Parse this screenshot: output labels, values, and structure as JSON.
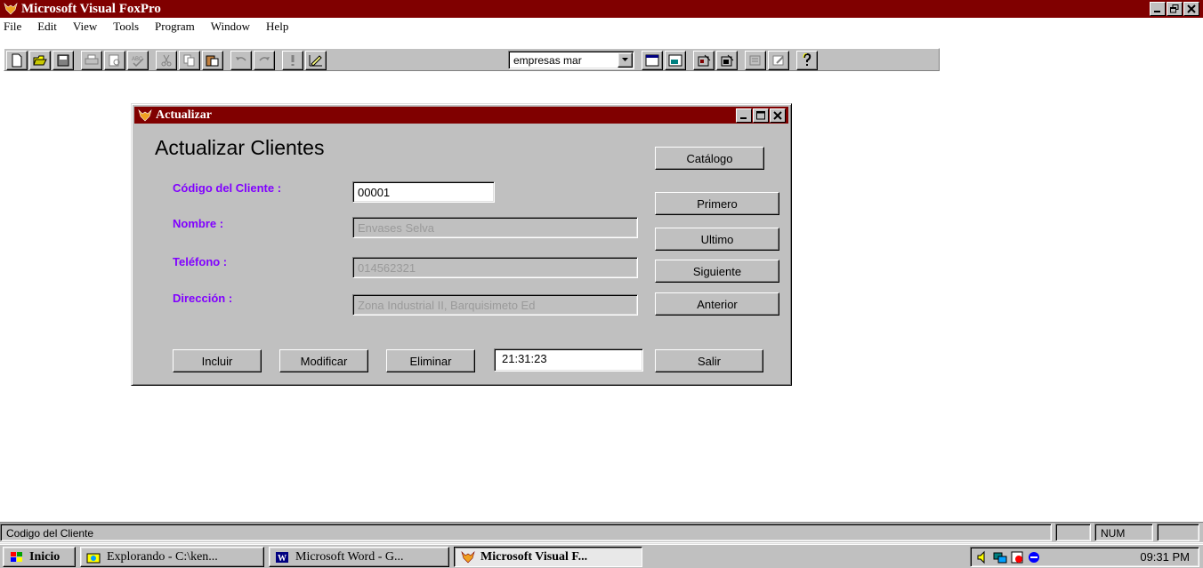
{
  "app": {
    "title": "Microsoft Visual FoxPro"
  },
  "menu": [
    "File",
    "Edit",
    "View",
    "Tools",
    "Program",
    "Window",
    "Help"
  ],
  "toolbar": {
    "database_combo_value": "empresas mar"
  },
  "form": {
    "window_title": "Actualizar",
    "heading": "Actualizar Clientes",
    "labels": {
      "codigo": "Código del Cliente :",
      "nombre": "Nombre :",
      "telefono": "Teléfono :",
      "direccion": "Dirección :"
    },
    "values": {
      "codigo": "00001",
      "nombre": "Envases Selva",
      "telefono": "014562321",
      "direccion": "Zona Industrial II, Barquisimeto Ed"
    },
    "buttons": {
      "catalogo": "Catálogo",
      "primero": "Primero",
      "ultimo": "Ultimo",
      "siguiente": "Siguiente",
      "anterior": "Anterior",
      "incluir": "Incluir",
      "modificar": "Modificar",
      "eliminar": "Eliminar",
      "salir": "Salir"
    },
    "clock": "21:31:23",
    "label_color": "#8000ff"
  },
  "statusbar": {
    "text": "Codigo del Cliente",
    "num": "NUM"
  },
  "taskbar": {
    "start": "Inicio",
    "tasks": [
      "Explorando - C:\\ken...",
      "Microsoft Word - G...",
      "Microsoft Visual F..."
    ],
    "time": "09:31 PM"
  },
  "colors": {
    "titlebar": "#800000",
    "face": "#c0c0c0"
  }
}
